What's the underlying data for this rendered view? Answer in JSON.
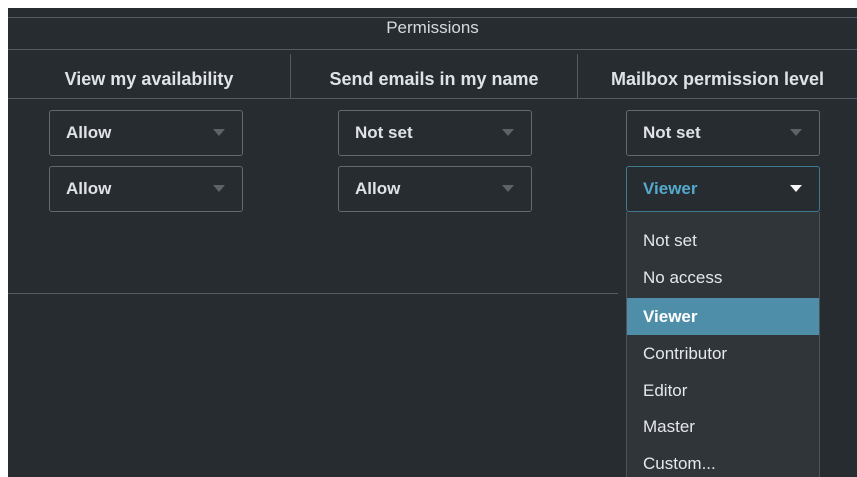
{
  "section": {
    "title": "Permissions"
  },
  "columns": [
    {
      "label": "View my availability"
    },
    {
      "label": "Send emails in my name"
    },
    {
      "label": "Mailbox permission level"
    }
  ],
  "rows": [
    {
      "availability": "Allow",
      "send_emails": "Not set",
      "mailbox_level": "Not set"
    },
    {
      "availability": "Allow",
      "send_emails": "Allow",
      "mailbox_level": "Viewer"
    }
  ],
  "dropdown": {
    "options": [
      "Not set",
      "No access",
      "Viewer",
      "Contributor",
      "Editor",
      "Master",
      "Custom..."
    ],
    "selected": "Viewer"
  },
  "colors": {
    "background": "#272c30",
    "divider": "#545b61",
    "selected_option": "#4e8ea8",
    "open_select_text": "#55a9cc"
  }
}
